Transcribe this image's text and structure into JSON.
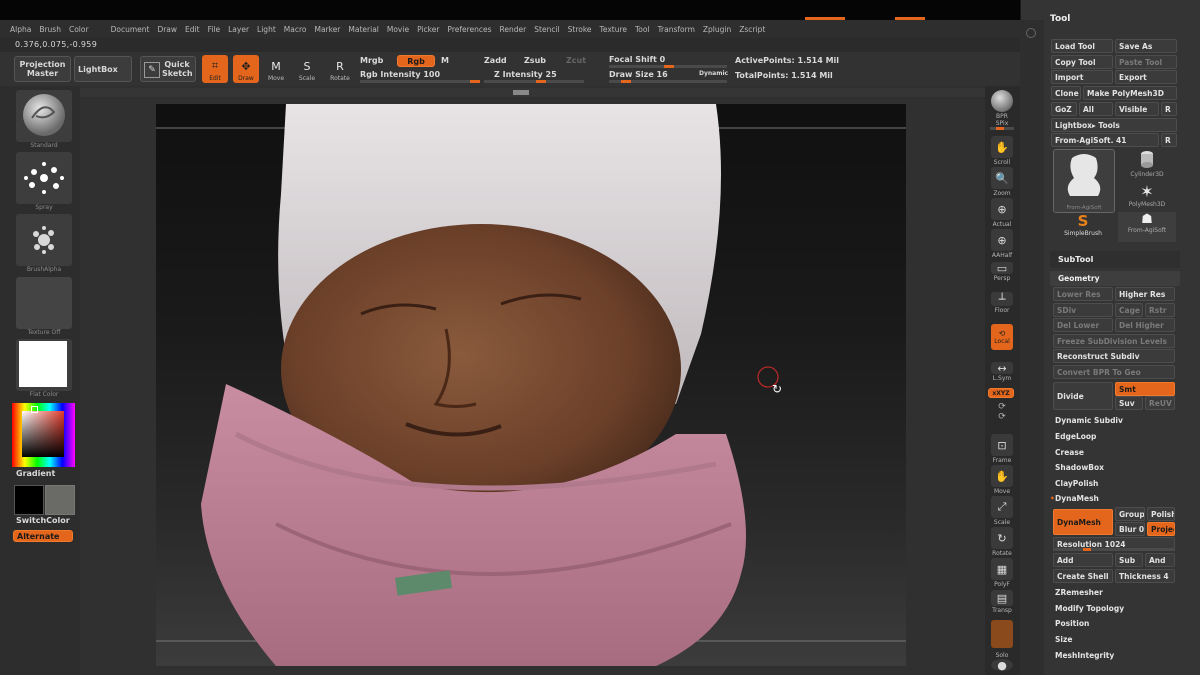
{
  "menu": [
    "Alpha",
    "Brush",
    "Color",
    "Document",
    "Draw",
    "Edit",
    "File",
    "Layer",
    "Light",
    "Macro",
    "Marker",
    "Material",
    "Movie",
    "Picker",
    "Preferences",
    "Render",
    "Stencil",
    "Stroke",
    "Texture",
    "Tool",
    "Transform",
    "Zplugin",
    "Zscript"
  ],
  "coords": "0.376,0.075,-0.959",
  "toolbar": {
    "projection_master": "Projection Master",
    "lightbox": "LightBox",
    "quick_sketch": "Quick Sketch",
    "edit": "Edit",
    "draw": "Draw",
    "move": "Move",
    "scale": "Scale",
    "rotate": "Rotate",
    "mrgb": "Mrgb",
    "rgb": "Rgb",
    "m": "M",
    "rgb_intensity": "Rgb Intensity 100",
    "zadd": "Zadd",
    "zsub": "Zsub",
    "zcut": "Zcut",
    "z_intensity": "Z Intensity 25",
    "focal_shift": "Focal Shift 0",
    "draw_size": "Draw Size 16",
    "dynamic": "Dynamic",
    "active_points": "ActivePoints: 1.514 Mil",
    "total_points": "TotalPoints: 1.514 Mil"
  },
  "left": {
    "standard": "Standard",
    "spray": "Spray",
    "brushalpha": "BrushAlpha",
    "texture_off": "Texture Off",
    "flat_color": "Flat Color",
    "gradient": "Gradient",
    "switchcolor": "SwitchColor",
    "alternate": "Alternate"
  },
  "shelf": [
    "BPR",
    "SPix",
    "Scroll",
    "Zoom",
    "Actual",
    "AAHalf",
    "Persp",
    "Floor",
    "Local",
    "L.Sym",
    "xXYZ",
    "Frame",
    "Move",
    "Scale",
    "Rotate",
    "PolyF",
    "Transp",
    "Solo"
  ],
  "tray": {
    "title": "Tool",
    "load_tool": "Load Tool",
    "save_as": "Save As",
    "copy_tool": "Copy Tool",
    "paste_tool": "Paste Tool",
    "import": "Import",
    "export": "Export",
    "clone": "Clone",
    "make_polymesh": "Make PolyMesh3D",
    "goz": "GoZ",
    "all": "All",
    "visible": "Visible",
    "r": "R",
    "lightbox_tools": "Lightbox▸ Tools",
    "current_tool": "From-AgiSoft. 41",
    "thumbs": [
      "From-AgiSoft",
      "Cylinder3D",
      "PolyMesh3D",
      "SimpleBrush",
      "From-AgiSoft"
    ],
    "subtool": "SubTool",
    "geometry": "Geometry",
    "lower_res": "Lower Res",
    "higher_res": "Higher Res",
    "sdiv": "SDiv",
    "cage": "Cage",
    "rstr": "Rstr",
    "del_lower": "Del Lower",
    "del_higher": "Del Higher",
    "freeze": "Freeze SubDivision Levels",
    "reconstruct": "Reconstruct Subdiv",
    "convert_bpr": "Convert BPR To Geo",
    "divide": "Divide",
    "smt": "Smt",
    "suv": "Suv",
    "reuv": "ReUV",
    "dynamic_subdiv": "Dynamic Subdiv",
    "edgeloop": "EdgeLoop",
    "crease": "Crease",
    "shadowbox": "ShadowBox",
    "claypolish": "ClayPolish",
    "dynamesh": "DynaMesh",
    "dynamesh_btn": "DynaMesh",
    "group": "Group",
    "polish": "Polish",
    "blur": "Blur 0",
    "project": "Project",
    "resolution": "Resolution 1024",
    "add": "Add",
    "sub": "Sub",
    "and": "And",
    "create_shell": "Create Shell",
    "thickness": "Thickness 4",
    "zremesher": "ZRemesher",
    "modify_topology": "Modify Topology",
    "position": "Position",
    "size": "Size",
    "meshintegrity": "MeshIntegrity"
  },
  "colors": {
    "accent": "#e4661c",
    "bg": "#2b2b2b"
  }
}
